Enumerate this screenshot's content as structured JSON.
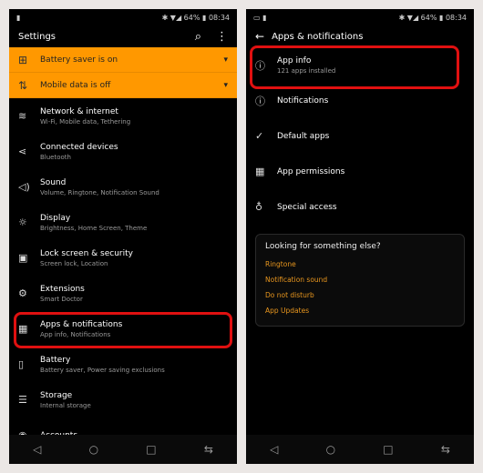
{
  "status": {
    "battery": "64%",
    "time": "08:34"
  },
  "left": {
    "title": "Settings",
    "banners": [
      {
        "icon": "battery-saver-icon",
        "glyph": "⊞",
        "label": "Battery saver is on"
      },
      {
        "icon": "mobile-data-icon",
        "glyph": "⇅",
        "label": "Mobile data is off"
      }
    ],
    "items": [
      {
        "icon": "wifi-icon",
        "glyph": "≋",
        "title": "Network & internet",
        "sub": "Wi-Fi, Mobile data, Tethering"
      },
      {
        "icon": "connected-devices-icon",
        "glyph": "⋖",
        "title": "Connected devices",
        "sub": "Bluetooth"
      },
      {
        "icon": "sound-icon",
        "glyph": "◁)",
        "title": "Sound",
        "sub": "Volume, Ringtone, Notification Sound"
      },
      {
        "icon": "display-icon",
        "glyph": "☼",
        "title": "Display",
        "sub": "Brightness, Home Screen, Theme"
      },
      {
        "icon": "lock-icon",
        "glyph": "▣",
        "title": "Lock screen & security",
        "sub": "Screen lock, Location"
      },
      {
        "icon": "extensions-icon",
        "glyph": "⚙",
        "title": "Extensions",
        "sub": "Smart Doctor"
      },
      {
        "icon": "apps-icon",
        "glyph": "▦",
        "title": "Apps & notifications",
        "sub": "App info, Notifications"
      },
      {
        "icon": "battery-icon",
        "glyph": "▯",
        "title": "Battery",
        "sub": "Battery saver, Power saving exclusions"
      },
      {
        "icon": "storage-icon",
        "glyph": "☰",
        "title": "Storage",
        "sub": "Internal storage"
      },
      {
        "icon": "accounts-icon",
        "glyph": "◉",
        "title": "Accounts",
        "sub": ""
      }
    ]
  },
  "right": {
    "title": "Apps & notifications",
    "items": [
      {
        "icon": "info-icon",
        "glyph": "ⓘ",
        "title": "App info",
        "sub": "121 apps installed"
      },
      {
        "icon": "notifications-icon",
        "glyph": "ⓘ",
        "title": "Notifications",
        "sub": ""
      },
      {
        "icon": "default-apps-icon",
        "glyph": "✓",
        "title": "Default apps",
        "sub": ""
      },
      {
        "icon": "app-permissions-icon",
        "glyph": "▦",
        "title": "App permissions",
        "sub": ""
      },
      {
        "icon": "special-access-icon",
        "glyph": "♁",
        "title": "Special access",
        "sub": ""
      }
    ],
    "card": {
      "heading": "Looking for something else?",
      "links": [
        "Ringtone",
        "Notification sound",
        "Do not disturb",
        "App Updates"
      ]
    }
  },
  "colors": {
    "accent": "#ff9800",
    "highlight": "#e01010",
    "link": "#e8961e"
  }
}
